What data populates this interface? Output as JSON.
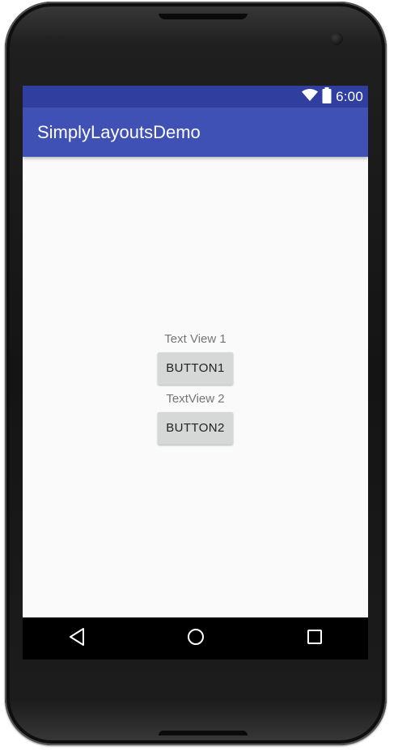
{
  "status_bar": {
    "time": "6:00",
    "icons": [
      "wifi-icon",
      "battery-icon"
    ]
  },
  "app_bar": {
    "title": "SimplyLayoutsDemo"
  },
  "main": {
    "text_view_1": "Text View 1",
    "button_1": "BUTTON1",
    "text_view_2": "TextView 2",
    "button_2": "BUTTON2"
  },
  "nav_bar": {
    "icons": [
      "back-icon",
      "home-icon",
      "recents-icon"
    ]
  },
  "colors": {
    "primary": "#3f51b5",
    "primary_dark": "#303f9f",
    "background": "#fafafa",
    "button": "#d6d7d7"
  }
}
